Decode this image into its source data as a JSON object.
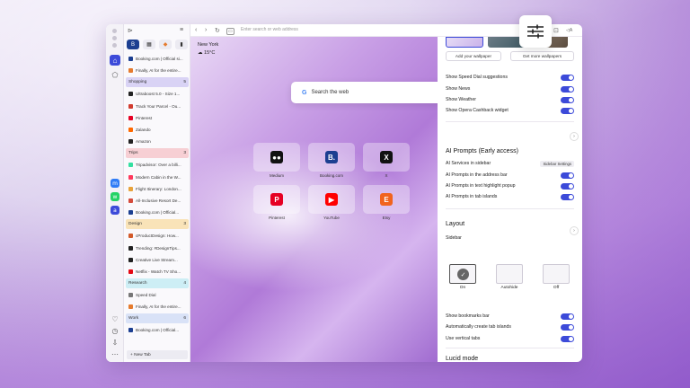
{
  "address_bar": {
    "placeholder": "Enter search or web address"
  },
  "pinned_tabs": [
    "B",
    "Menu",
    "Y",
    "Pin"
  ],
  "tabs_top": [
    {
      "label": "Booking.com | Official si...",
      "color": "#1c3f91"
    },
    {
      "label": "Finally, AI for the entire...",
      "color": "#e57b2e"
    }
  ],
  "groups": [
    {
      "name": "Shopping",
      "count": "5",
      "color": "#d9d3f5",
      "tabs": [
        {
          "label": "Ultraboost 5.0 - Size 1...",
          "color": "#222"
        },
        {
          "label": "Track Your Parcel - Ou...",
          "color": "#d13b2f"
        },
        {
          "label": "Pinterest",
          "color": "#e60023"
        },
        {
          "label": "Zalando",
          "color": "#ff6900"
        },
        {
          "label": "Amazon",
          "color": "#222"
        }
      ]
    },
    {
      "name": "Trips",
      "count": "3",
      "color": "#f7cfd4",
      "tabs": [
        {
          "label": "Tripadvisor: Over a billi...",
          "color": "#34e0a1"
        },
        {
          "label": "Modern Cabin in the W...",
          "color": "#ff385c"
        },
        {
          "label": "Flight Itinerary: London...",
          "color": "#e8a33c"
        },
        {
          "label": "All-Inclusive Resort De...",
          "color": "#d54b3c"
        },
        {
          "label": "Booking.com | Official...",
          "color": "#1c3f91"
        }
      ]
    },
    {
      "name": "Design",
      "count": "3",
      "color": "#f9e3b8",
      "tabs": [
        {
          "label": "cProductDesign: How...",
          "color": "#d35a2a"
        },
        {
          "label": "Trending: #DesignTips...",
          "color": "#222"
        },
        {
          "label": "Creative Live Stream...",
          "color": "#222"
        },
        {
          "label": "Netflix - Watch TV Sho...",
          "color": "#e50914"
        }
      ]
    },
    {
      "name": "Research",
      "count": "4",
      "color": "#cdeef5",
      "tabs": [
        {
          "label": "Speed Dial",
          "color": "#777"
        },
        {
          "label": "Finally, AI for the entire...",
          "color": "#e57b2e"
        }
      ]
    },
    {
      "name": "Work",
      "count": "6",
      "color": "#d9e2f7",
      "tabs": [
        {
          "label": "Booking.com | Official...",
          "color": "#1c3f91"
        }
      ]
    }
  ],
  "new_tab_label": "New Tab",
  "weather": {
    "city": "New York",
    "temp": "15°C"
  },
  "search": {
    "placeholder": "Search the web"
  },
  "speed_dial": [
    {
      "label": "Medium",
      "glyph": "●●",
      "bg": "#111",
      "fg": "#fff"
    },
    {
      "label": "Booking.com",
      "glyph": "B.",
      "bg": "#1c3f91",
      "fg": "#fff"
    },
    {
      "label": "X",
      "glyph": "X",
      "bg": "#111",
      "fg": "#fff"
    },
    {
      "label": "Pinterest",
      "glyph": "P",
      "bg": "#e60023",
      "fg": "#fff"
    },
    {
      "label": "YouTube",
      "glyph": "▶",
      "bg": "#ff0000",
      "fg": "#fff"
    },
    {
      "label": "Etsy",
      "glyph": "E",
      "bg": "#f1641e",
      "fg": "#fff"
    }
  ],
  "settings": {
    "wallpaper_buttons": [
      "Add your wallpaper",
      "Get more wallpapers"
    ],
    "toggles_top": [
      "Show Speed Dial suggestions",
      "Show News",
      "Show Weather",
      "Show Opera Cashback widget"
    ],
    "ai_title": "AI Prompts (Early access)",
    "ai_services": "AI Services in sidebar",
    "sidebar_settings": "Sidebar Settings",
    "ai_toggles": [
      "AI Prompts in the address bar",
      "AI Prompts in text highlight popup",
      "AI Prompts in tab islands"
    ],
    "layout_title": "Layout",
    "sidebar_label": "Sidebar",
    "sidebar_modes": [
      "On",
      "Autohide",
      "Off"
    ],
    "layout_toggles": [
      "Show bookmarks bar",
      "Automatically create tab islands",
      "Use vertical tabs"
    ],
    "lucid_title": "Lucid mode"
  }
}
